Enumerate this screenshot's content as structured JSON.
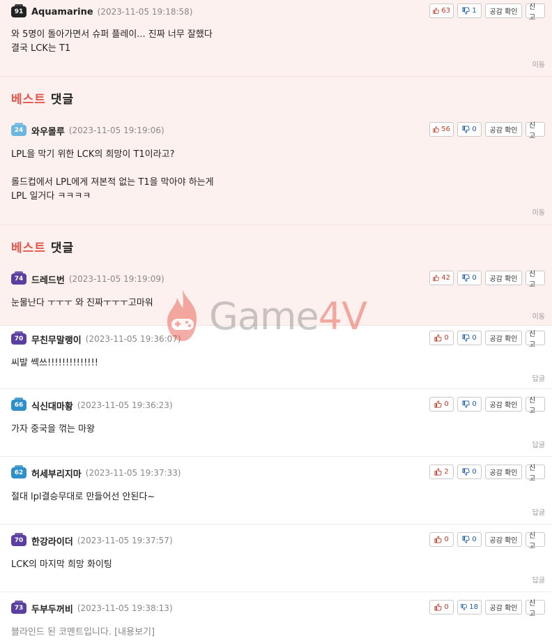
{
  "comments": [
    {
      "level": "91",
      "level_color": "#222222",
      "nick": "Aquamarine",
      "date": "(2023-11-05 19:18:58)",
      "likes": "63",
      "dislikes": "1",
      "empathy": "공감 확인",
      "report": "신고",
      "body": "와 5명이 돌아가면서 슈퍼 플레이... 진짜 너무 잘했다\n결국 LCK는 T1",
      "footer": "이동",
      "best": true
    },
    {
      "best_label_1": "베스트",
      "best_label_2": "댓글",
      "level": "24",
      "level_color": "#6bb7e0",
      "nick": "와우몰루",
      "date": "(2023-11-05 19:19:06)",
      "likes": "56",
      "dislikes": "0",
      "empathy": "공감 확인",
      "report": "신고",
      "body": "LPL을 막기 위한 LCK의 희망이 T1이라고?\n\n롤드컵에서 LPL에게 져본적 없는 T1을 막아야 하는게\nLPL 일거다 ㅋㅋㅋㅋ",
      "footer": "이동",
      "best": true
    },
    {
      "best_label_1": "베스트",
      "best_label_2": "댓글",
      "level": "74",
      "level_color": "#5a3fa0",
      "nick": "드레드번",
      "date": "(2023-11-05 19:19:09)",
      "likes": "42",
      "dislikes": "0",
      "empathy": "공감 확인",
      "report": "신고",
      "body": "눈물난다 ㅜㅜㅜ 와 진짜ㅜㅜㅜ고마워",
      "footer": "이동",
      "best": true
    },
    {
      "level": "70",
      "level_color": "#5a3fa0",
      "nick": "무친무말랭이",
      "date": "(2023-11-05 19:36:07)",
      "likes": "0",
      "dislikes": "0",
      "empathy": "공감 확인",
      "report": "신고",
      "body": "씨발 쎅쓰!!!!!!!!!!!!!!",
      "footer": "답글"
    },
    {
      "level": "66",
      "level_color": "#2f8fc9",
      "nick": "식신대마황",
      "date": "(2023-11-05 19:36:23)",
      "likes": "0",
      "dislikes": "0",
      "empathy": "공감 확인",
      "report": "신고",
      "body": "가자 중국을 꺾는 마왕",
      "footer": "답글"
    },
    {
      "level": "62",
      "level_color": "#2f8fc9",
      "nick": "허세부리지마",
      "date": "(2023-11-05 19:37:33)",
      "likes": "2",
      "dislikes": "0",
      "empathy": "공감 확인",
      "report": "신고",
      "body": "절대 lpl결승무대로 만들어선 안된다~",
      "footer": "답글"
    },
    {
      "level": "70",
      "level_color": "#5a3fa0",
      "nick": "한강라이더",
      "date": "(2023-11-05 19:37:57)",
      "likes": "0",
      "dislikes": "0",
      "empathy": "공감 확인",
      "report": "신고",
      "body": "LCK의 마지막 희망 화이팅",
      "footer": "답글"
    },
    {
      "level": "73",
      "level_color": "#5a3fa0",
      "nick": "두부두꺼비",
      "date": "(2023-11-05 19:38:13)",
      "likes": "0",
      "dislikes": "18",
      "empathy": "공감 확인",
      "report": "신고",
      "body": "블라인드 된 코멘트입니다. [내용보기]",
      "footer": ""
    }
  ],
  "watermark": {
    "text_main": "Game",
    "text_accent": "4V"
  }
}
